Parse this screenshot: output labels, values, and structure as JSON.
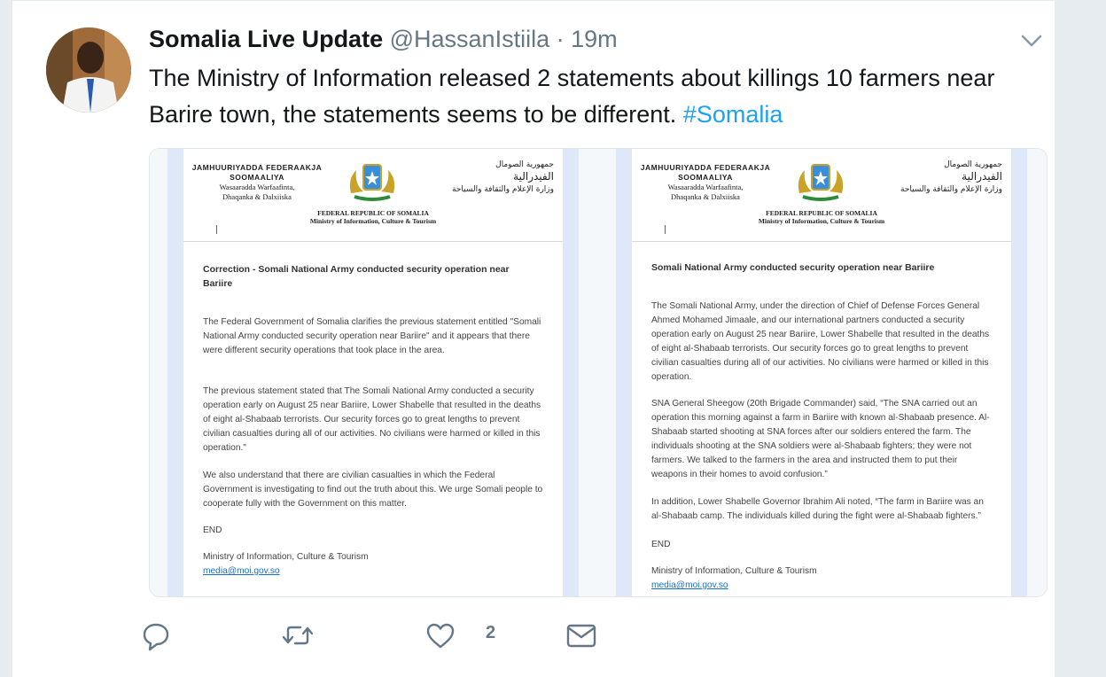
{
  "tweet": {
    "author_name": "Somalia Live Update",
    "handle": "@HassanIstiila",
    "separator": "·",
    "time": "19m",
    "text": "The Ministry of Information released 2 statements about killings 10 farmers near Barire town, the statements seems to be different.",
    "hashtag": "#Somalia",
    "like_count": "2"
  },
  "letterhead": {
    "so_line1": "JAMHUURIYADDA FEDERAAKJA",
    "so_line2": "SOOMAALIYA",
    "so_line3": "Wasaaradda Warfaafinta,",
    "so_line4": "Dhaqanka & Dalxiiska",
    "ar_line1": "جمهورية الصومال",
    "ar_line2": "الفيدرالية",
    "ar_line3": "وزارة الإعلام والثقافة والسياحة",
    "en_line1": "FEDERAL REPUBLIC OF SOMALIA",
    "en_line2": "Ministry of Information, Culture & Tourism"
  },
  "doc_left": {
    "title": "Correction - Somali National Army conducted security operation near Bariire",
    "p1": "The Federal Government of Somalia clarifies the previous statement entitled \"Somali National Army conducted security operation near Bariire\" and it appears that there were different security operations that took place in the area.",
    "p2": "The previous statement stated that The Somali National Army conducted a security operation early on August 25 near Bariire, Lower Shabelle that resulted in the deaths of eight al-Shabaab terrorists. Our security forces go to great lengths to prevent civilian casualties during all of our activities. No civilians were harmed or killed in this operation.\"",
    "p3": "We also understand that there are civilian casualties in which the Federal Government is investigating to find out the truth about this. We urge Somali people to cooperate fully with the Government on this matter.",
    "end": "END",
    "signature": "Ministry of Information, Culture & Tourism",
    "email": "media@moi.gov.so"
  },
  "doc_right": {
    "title": "Somali National Army conducted security operation near Bariire",
    "p1": "The Somali National Army, under the direction of Chief of Defense Forces General Ahmed Mohamed Jimaale, and our international partners conducted a security operation early on August 25 near Bariire, Lower Shabelle that resulted in the deaths of eight al-Shabaab terrorists. Our security forces go to great lengths to prevent civilian casualties during all of our activities. No civilians were harmed or killed in this operation.",
    "p2": "SNA General Sheegow (20th Brigade Commander) said, “The SNA carried out an operation this morning against a farm in Bariire with known al-Shabaab presence. Al-Shabaab started shooting at SNA forces after our soldiers entered the farm. The individuals shooting at the SNA soldiers were al-Shabaab fighters; they were not farmers. We talked to the farmers in the area and instructed them to put their weapons in their homes to avoid confusion.”",
    "p3": "In addition, Lower Shabelle Governor Ibrahim Ali noted, “The farm in Bariire was an al-Shabaab camp. The individuals killed during the fight were al-Shabaab fighters.”",
    "end": "END",
    "signature": "Ministry of Information, Culture & Tourism",
    "email": "media@moi.gov.so"
  },
  "icons": {
    "reply": "reply-icon",
    "retweet": "retweet-icon",
    "like": "heart-icon",
    "dm": "envelope-icon",
    "menu": "chevron-down-icon"
  },
  "colors": {
    "link": "#1da1f2",
    "text": "#14171a",
    "muted": "#657786",
    "background": "#e6ecf0"
  }
}
